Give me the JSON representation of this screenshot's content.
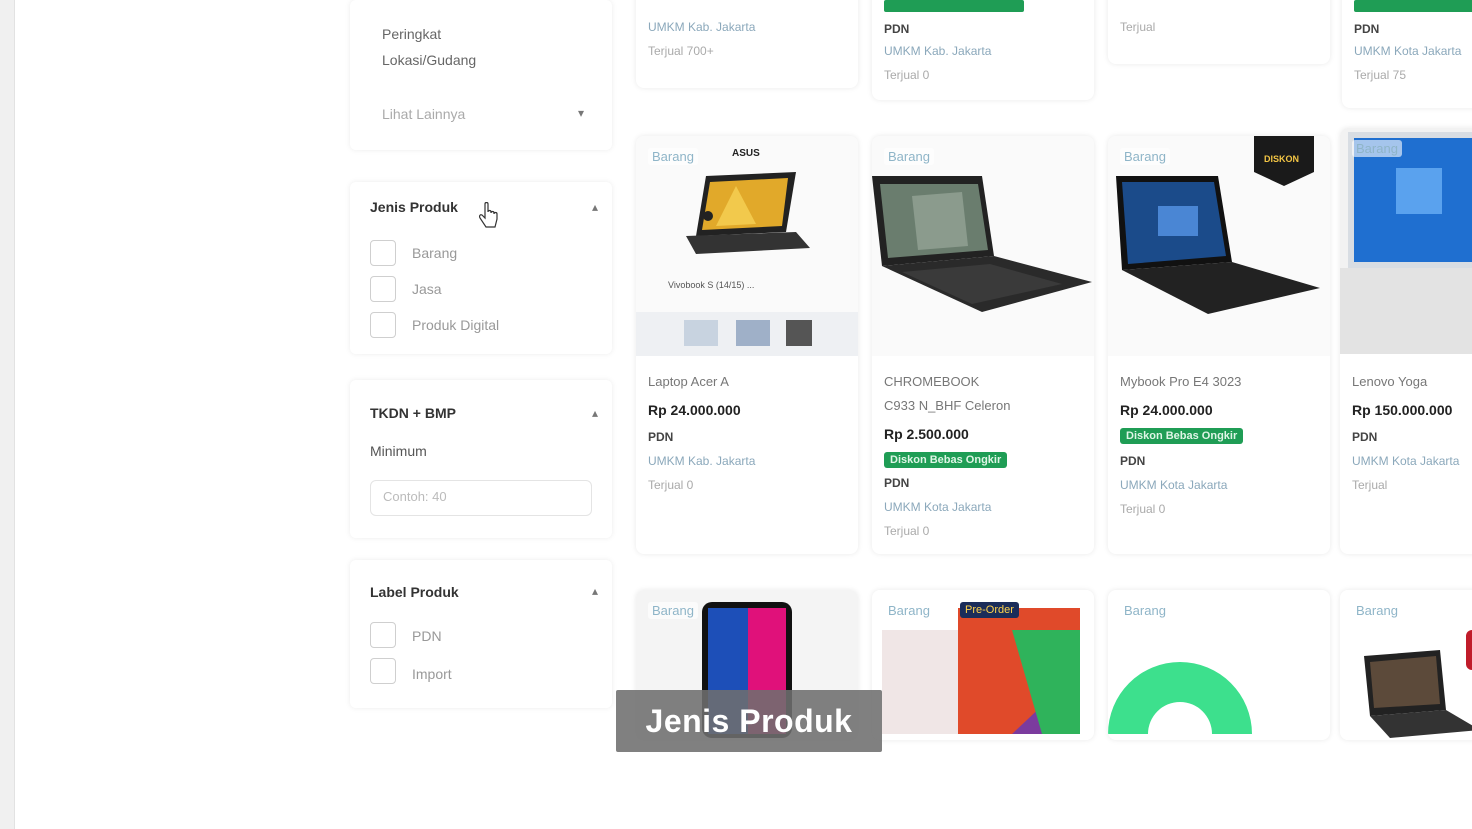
{
  "sidebar": {
    "top_panel": {
      "line1": "Peringkat",
      "line2": "Lokasi/Gudang",
      "dropdown": "Lihat Lainnya"
    },
    "product_type": {
      "title": "Jenis Produk",
      "options": [
        "Barang",
        "Jasa",
        "Produk Digital"
      ]
    },
    "tkdn": {
      "title": "TKDN + BMP",
      "min_label": "Minimum",
      "placeholder": "Contoh: 40"
    },
    "label": {
      "title": "Label Produk",
      "options": [
        "PDN",
        "Import"
      ]
    }
  },
  "top_row": [
    {
      "location": "UMKM  Kab. Jakarta",
      "rating": "Terjual 700+"
    },
    {
      "sold": "PDN",
      "location": "UMKM  Kab. Jakarta",
      "rating": "Terjual 0"
    },
    {
      "rating": "Terjual"
    },
    {
      "sold": "PDN",
      "location": "UMKM  Kota Jakarta",
      "rating": "Terjual 75"
    }
  ],
  "products": [
    {
      "badge": "Barang",
      "name": "Laptop Acer A",
      "price": "Rp 24.000.000",
      "sold": "PDN",
      "location": "UMKM  Kab. Jakarta",
      "rating": "Terjual 0",
      "brand": "ASUS",
      "caption": "Vivobook S (14/15) ..."
    },
    {
      "badge": "Barang",
      "name": "CHROMEBOOK",
      "name2": "C933 N_BHF Celeron",
      "price": "Rp 2.500.000",
      "cashback": "Diskon Bebas Ongkir",
      "sold": "PDN",
      "location": "UMKM  Kota Jakarta",
      "rating": "Terjual 0"
    },
    {
      "badge": "Barang",
      "name": "Mybook Pro E4 3023",
      "price": "Rp 24.000.000",
      "cashback": "Diskon Bebas Ongkir",
      "sold": "PDN",
      "location": "UMKM  Kota Jakarta",
      "rating": "Terjual 0",
      "corner_badge": "DISKON"
    },
    {
      "badge": "Barang",
      "name": "Lenovo Yoga",
      "price": "Rp 150.000.000",
      "sold": "PDN",
      "location": "UMKM  Kota Jakarta",
      "rating": "Terjual"
    }
  ],
  "bottom_row": [
    {
      "badge": "Barang"
    },
    {
      "badge": "Barang",
      "preorder": "Pre-Order"
    },
    {
      "badge": "Barang"
    },
    {
      "badge": "Barang"
    }
  ],
  "overlay_caption": "Jenis Produk",
  "colors": {
    "cashback_green": "#1f9d55",
    "badge_blue": "#8fb5c8"
  }
}
